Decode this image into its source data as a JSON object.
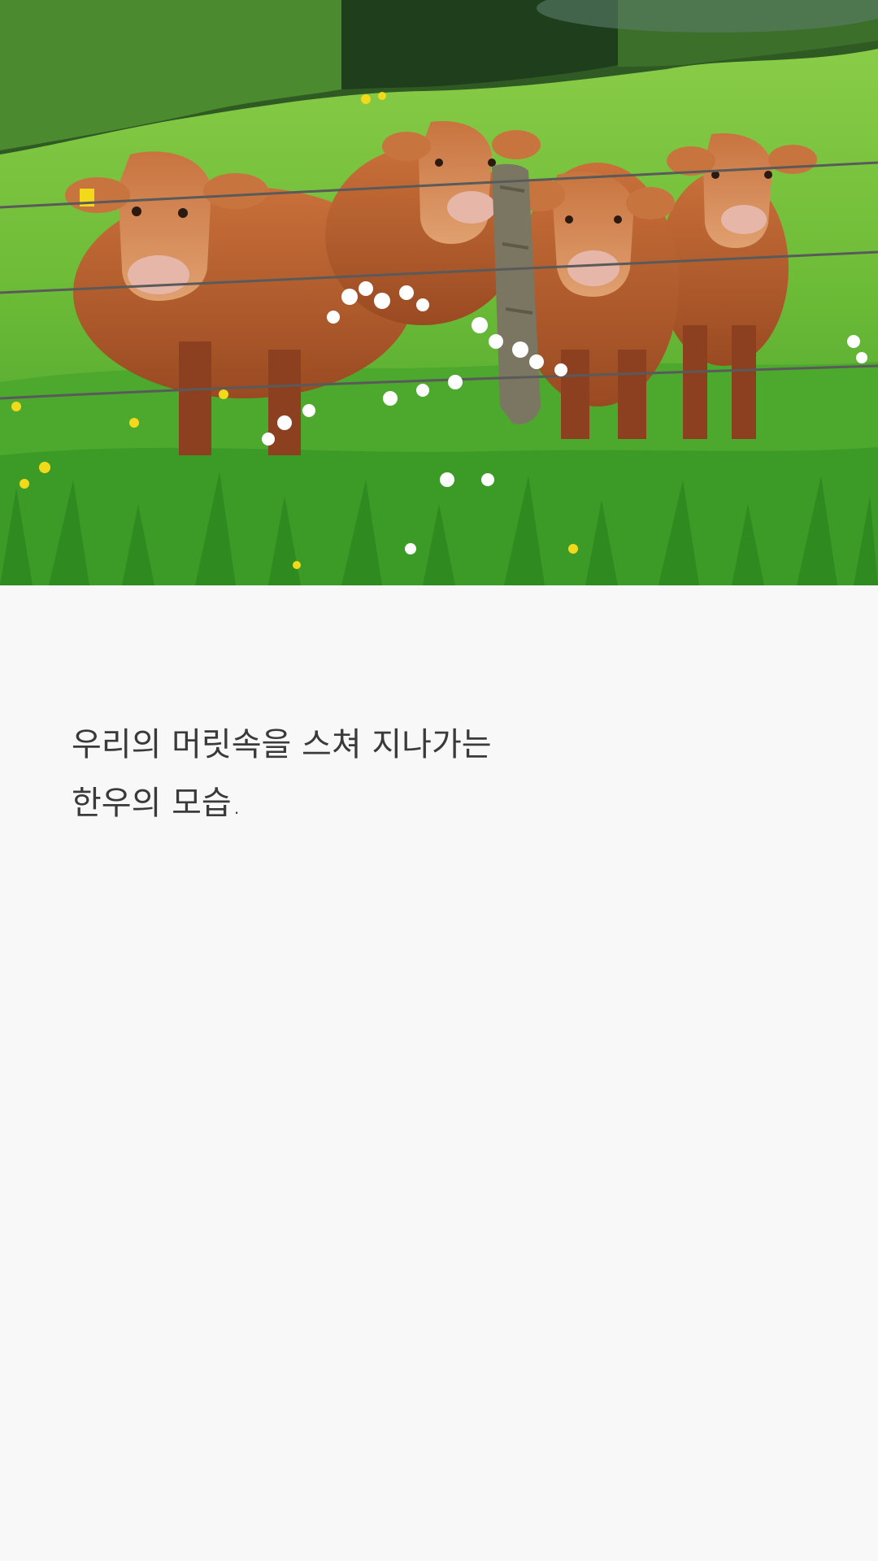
{
  "hero": {
    "image_name": "cows-behind-barbed-wire-fence",
    "colors": {
      "sky_trees": "#2f5a24",
      "grass_light": "#6fbf3a",
      "grass_dark": "#3f8f2a",
      "cow": "#b5582a",
      "cow_light": "#d98c55",
      "flowers": "#ffffff",
      "dandelion": "#f2d91a"
    }
  },
  "caption": {
    "line1": "우리의 머릿속을 스쳐 지나가는",
    "line2": "한우의 모습."
  }
}
